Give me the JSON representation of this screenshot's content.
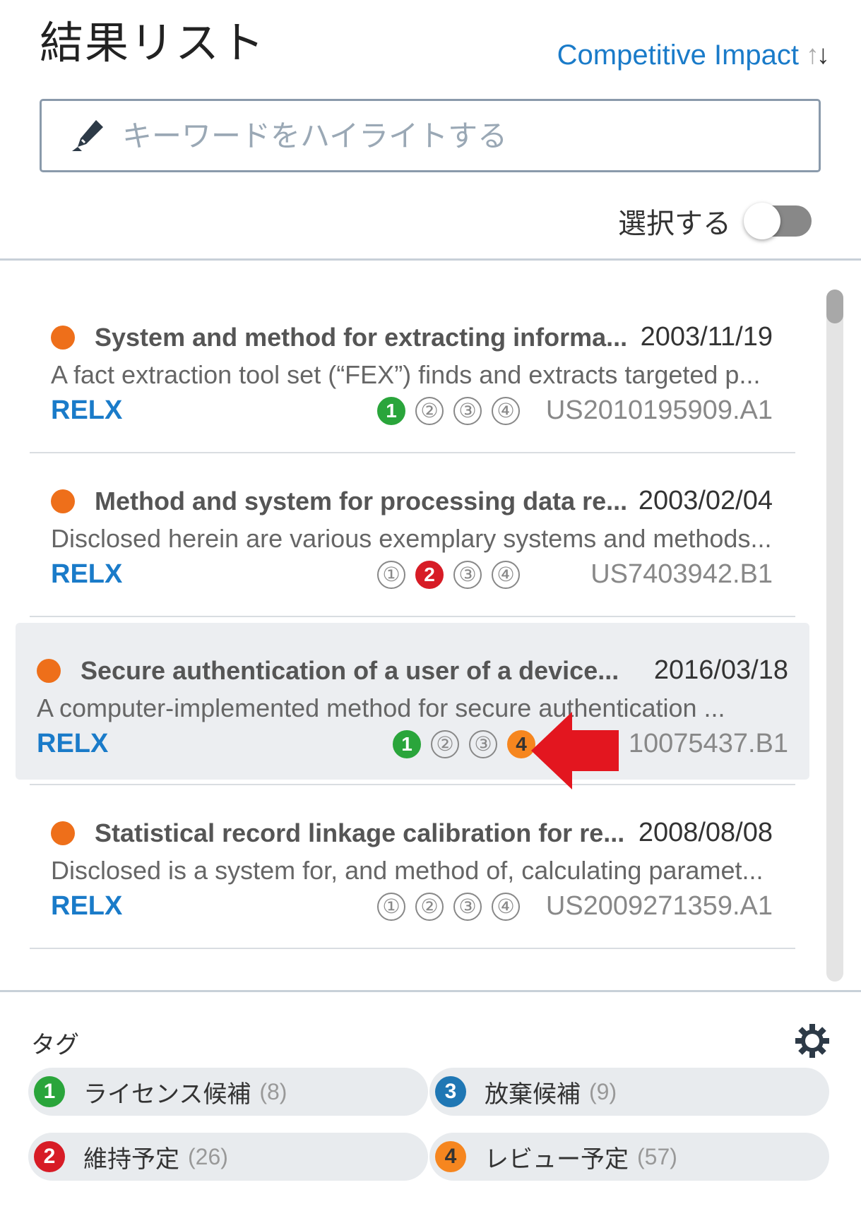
{
  "header": {
    "title": "結果リスト",
    "sort_label": "Competitive Impact",
    "sort_arrow_up": "↑",
    "sort_arrow_down": "↓"
  },
  "search": {
    "placeholder": "キーワードをハイライトする",
    "value": ""
  },
  "select": {
    "label": "選択する",
    "enabled": false
  },
  "results": [
    {
      "title": "System and method for extracting informa...",
      "date": "2003/11/19",
      "abstract": "A fact extraction tool set (“FEX”) finds and extracts targeted p...",
      "assignee": "RELX",
      "tags": [
        "1",
        "②",
        "③",
        "④"
      ],
      "active_tag": 1,
      "id": "US2010195909.A1"
    },
    {
      "title": "Method and system for processing data re...",
      "date": "2003/02/04",
      "abstract": "Disclosed herein are various exemplary systems and methods...",
      "assignee": "RELX",
      "tags": [
        "①",
        "2",
        "③",
        "④"
      ],
      "active_tag": 2,
      "id": "US7403942.B1"
    },
    {
      "title": "Secure authentication of a user of a device...",
      "date": "2016/03/18",
      "abstract": "A computer-implemented method for secure authentication ...",
      "assignee": "RELX",
      "tags": [
        "1",
        "②",
        "③",
        "4"
      ],
      "active_tag": 1,
      "id": "10075437.B1"
    },
    {
      "title": "Statistical record linkage calibration for re...",
      "date": "2008/08/08",
      "abstract": "Disclosed is a system for, and method of, calculating paramet...",
      "assignee": "RELX",
      "tags": [
        "①",
        "②",
        "③",
        "④"
      ],
      "active_tag": 0,
      "id": "US2009271359.A1"
    }
  ],
  "tags_panel": {
    "label": "タグ",
    "items": [
      {
        "num": "1",
        "name": "ライセンス候補",
        "count": "(8)",
        "color": "#2aa53b"
      },
      {
        "num": "3",
        "name": "放棄候補",
        "count": "(9)",
        "color": "#1f77b4"
      },
      {
        "num": "2",
        "name": "維持予定",
        "count": "(26)",
        "color": "#d71c26"
      },
      {
        "num": "4",
        "name": "レビュー予定",
        "count": "(57)",
        "color": "#f6861f"
      }
    ]
  },
  "colors": {
    "accent": "#1a7bc9",
    "status_dot": "#ee6f1a",
    "annotation_arrow": "#e3161f"
  }
}
